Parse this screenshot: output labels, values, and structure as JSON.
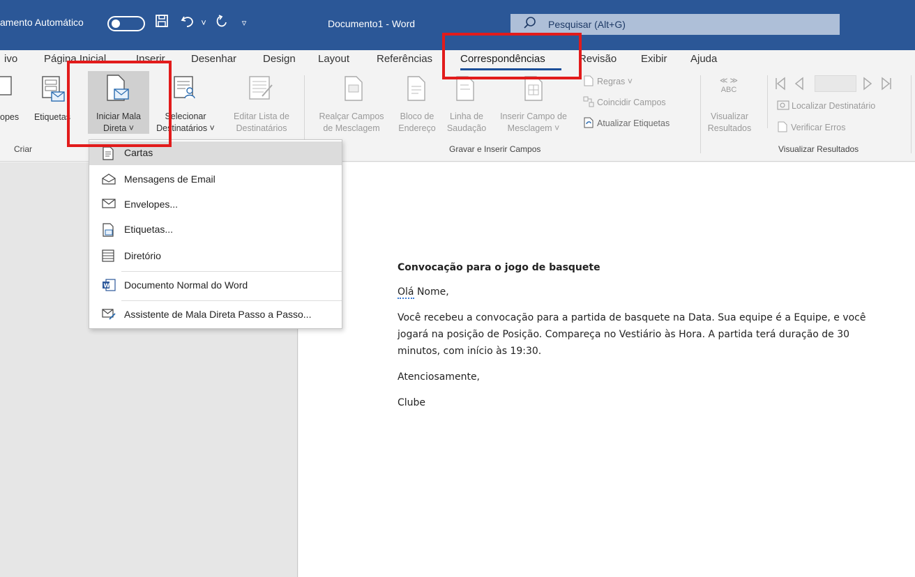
{
  "titlebar": {
    "autosave_label": "amento Automático",
    "document_title": "Documento1  -  Word",
    "search_placeholder": "Pesquisar (Alt+G)"
  },
  "tabs": [
    {
      "label": "ivo"
    },
    {
      "label": "Página Inicial"
    },
    {
      "label": "Inserir"
    },
    {
      "label": "Desenhar"
    },
    {
      "label": "Design"
    },
    {
      "label": "Layout"
    },
    {
      "label": "Referências"
    },
    {
      "label": "Correspondências",
      "active": true
    },
    {
      "label": "Revisão"
    },
    {
      "label": "Exibir"
    },
    {
      "label": "Ajuda"
    }
  ],
  "ribbon": {
    "envelopes_label": "opes",
    "etiquetas_label": "Etiquetas",
    "iniciar_line1": "Iniciar Mala",
    "iniciar_line2": "Direta ˅",
    "selecionar_line1": "Selecionar",
    "selecionar_line2": "Destinatários ˅",
    "editar_line1": "Editar Lista de",
    "editar_line2": "Destinatários",
    "realcar_line1": "Realçar Campos",
    "realcar_line2": "de Mesclagem",
    "bloco_line1": "Bloco de",
    "bloco_line2": "Endereço",
    "linha_line1": "Linha de",
    "linha_line2": "Saudação",
    "inserir_campo_line1": "Inserir Campo de",
    "inserir_campo_line2": "Mesclagem ˅",
    "regras": "Regras ˅",
    "coincidir": "Coincidir Campos",
    "atualizar": "Atualizar Etiquetas",
    "abc": "ABC",
    "visualizar_line1": "Visualizar",
    "visualizar_line2": "Resultados",
    "localizar": "Localizar Destinatário",
    "verificar": "Verificar Erros",
    "group_criar": "Criar",
    "group_gravar": "Gravar e Inserir Campos",
    "group_visualizar": "Visualizar Resultados"
  },
  "menu": {
    "items": [
      {
        "label": "Cartas",
        "icon": "letter-doc-icon"
      },
      {
        "label": "Mensagens de Email",
        "icon": "email-icon"
      },
      {
        "label": "Envelopes...",
        "icon": "envelope-icon"
      },
      {
        "label": "Etiquetas...",
        "icon": "label-icon"
      },
      {
        "label": "Diretório",
        "icon": "directory-icon"
      },
      {
        "label": "Documento Normal do Word",
        "icon": "word-doc-icon"
      },
      {
        "label": "Assistente de Mala Direta Passo a Passo...",
        "icon": "wizard-icon"
      }
    ]
  },
  "document": {
    "title": "Convocação para o jogo de basquete",
    "greeting_word": "Olá",
    "greeting_rest": " Nome,",
    "body_line1": "Você recebeu a convocação para a partida de basquete na Data. Sua equipe é a Equipe, e você",
    "body_line2": "jogará na posição de Posição. Compareça no Vestiário às Hora. A partida terá duração de 30",
    "body_line3": "minutos, com início às 19:30.",
    "closing": "Atenciosamente,",
    "signature": "Clube"
  }
}
